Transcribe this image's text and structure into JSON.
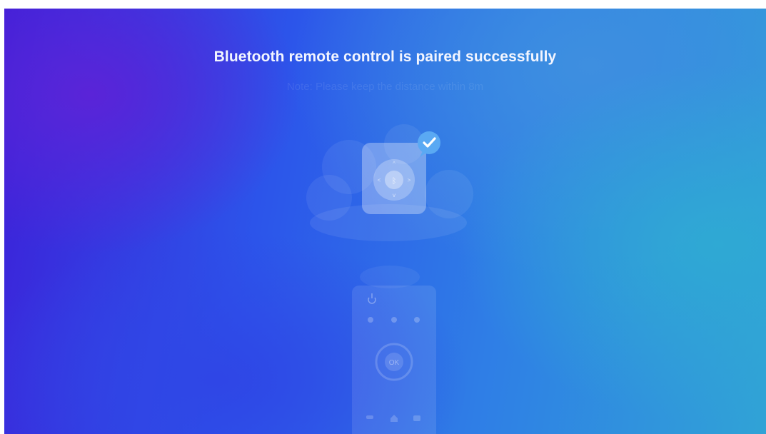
{
  "dialog": {
    "title": "Bluetooth remote control is paired successfully",
    "note": "Note: Please keep the distance within 8m"
  },
  "bottom_remote": {
    "ok_label": "OK"
  },
  "icons": {
    "status": "check-badge-icon",
    "remote": "remote-control-icon",
    "bluetooth": "bluetooth-icon",
    "power": "power-icon",
    "home": "home-icon",
    "back": "back-icon",
    "menu": "menu-icon"
  },
  "colors": {
    "title_text": "#f2f5ff",
    "check_badge": "#4ea3f3",
    "background_left": "#3d1fd8",
    "background_right": "#30a3d6"
  }
}
